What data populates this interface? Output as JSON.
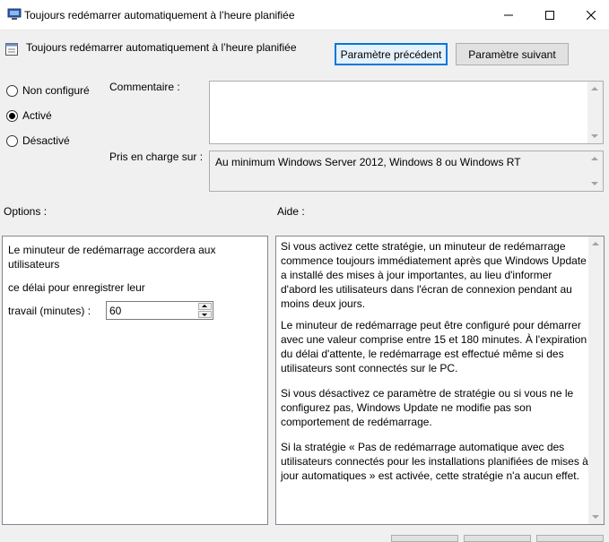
{
  "window": {
    "title": "Toujours redémarrer automatiquement à l’heure planifiée"
  },
  "header": {
    "title": "Toujours redémarrer automatiquement à l’heure planifiée",
    "prev_button": "Paramètre précédent",
    "next_button": "Paramètre suivant"
  },
  "state": {
    "options": [
      "Non configuré",
      "Activé",
      "Désactivé"
    ],
    "selected": "Activé"
  },
  "comment": {
    "label": "Commentaire :",
    "value": ""
  },
  "supported": {
    "label": "Pris en charge sur :",
    "value": "Au minimum Windows Server 2012, Windows 8 ou Windows RT"
  },
  "options_section": {
    "label": "Options :",
    "line1": "Le minuteur de redémarrage accordera aux",
    "line2": "utilisateurs",
    "line3": "ce délai pour enregistrer leur",
    "spinner_label": "travail (minutes) :",
    "spinner_value": "60"
  },
  "help_section": {
    "label": "Aide :",
    "paragraphs": [
      "Si vous activez cette stratégie, un minuteur de redémarrage commence toujours immédiatement après que Windows Update a installé des mises à jour importantes, au lieu d'informer d'abord les utilisateurs dans l'écran de connexion pendant au moins deux jours.",
      "Le minuteur de redémarrage peut être configuré pour démarrer avec une valeur comprise entre 15 et 180 minutes. À l'expiration du délai d'attente, le redémarrage est effectué même si des utilisateurs sont connectés sur le PC.",
      "Si vous désactivez ce paramètre de stratégie ou si vous ne le configurez pas, Windows Update ne modifie pas son comportement de redémarrage.",
      "Si la stratégie « Pas de redémarrage automatique avec des utilisateurs connectés pour les installations planifiées de mises à jour automatiques » est activée, cette stratégie n'a aucun effet."
    ]
  },
  "icons": {
    "title": "policy-window-icon",
    "header": "policy-setting-icon"
  },
  "colors": {
    "accent": "#0078d7",
    "background": "#f0f0f0"
  }
}
